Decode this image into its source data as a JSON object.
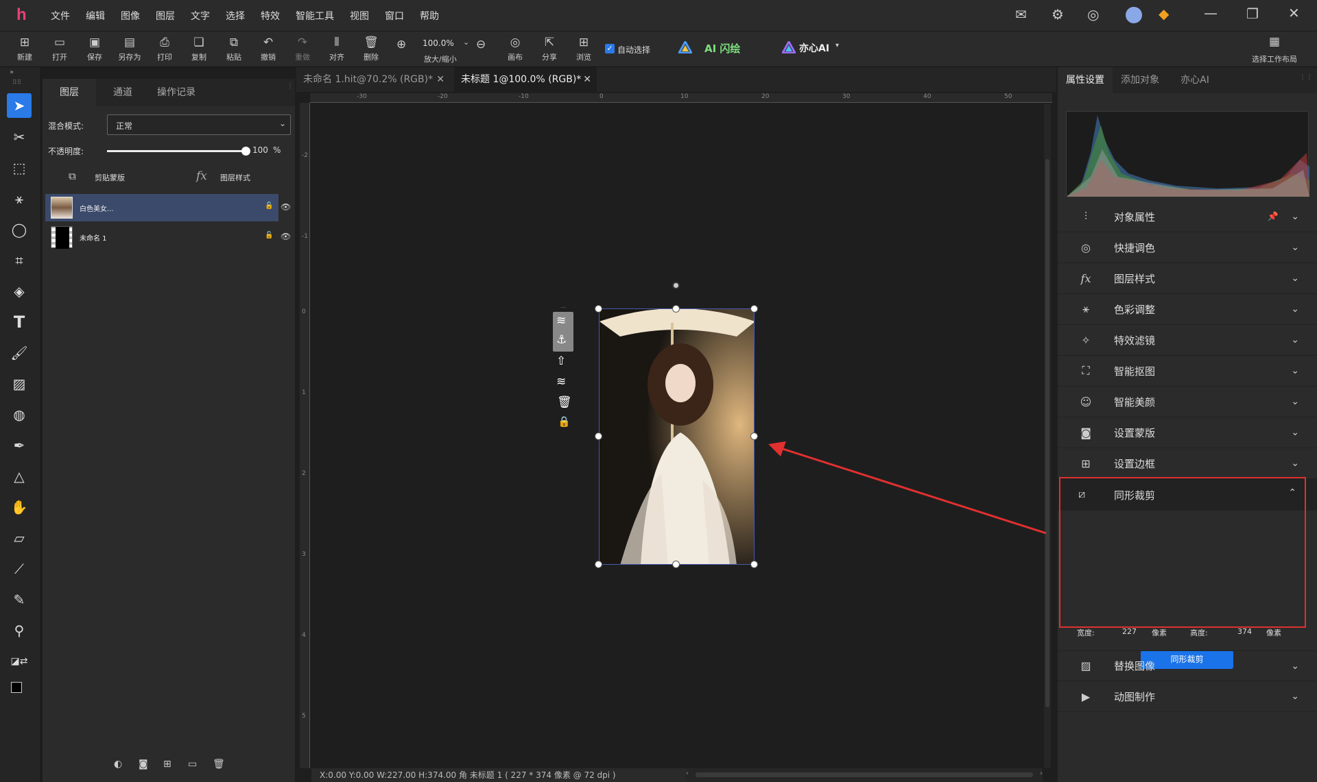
{
  "app": {
    "logo": "h"
  },
  "menu": [
    "文件",
    "编辑",
    "图像",
    "图层",
    "文字",
    "选择",
    "特效",
    "智能工具",
    "视图",
    "窗口",
    "帮助"
  ],
  "toolbar": {
    "new": "新建",
    "open": "打开",
    "save": "保存",
    "save_as": "另存为",
    "print": "打印",
    "copy": "复制",
    "paste": "粘贴",
    "undo": "撤销",
    "redo": "重做",
    "align": "对齐",
    "delete": "删除",
    "zoom_value": "100.0%",
    "zoom_label": "放大/缩小",
    "canvas": "画布",
    "share": "分享",
    "browse": "浏览",
    "auto_select": "自动选择",
    "ai_flash": "AI 闪绘",
    "yixin_ai": "亦心AI",
    "layout": "选择工作布局"
  },
  "layers_panel": {
    "tabs": [
      "图层",
      "通道",
      "操作记录"
    ],
    "blend_label": "混合模式:",
    "blend_value": "正常",
    "opacity_label": "不透明度:",
    "opacity_value": "100",
    "opacity_unit": "%",
    "opacity_fraction": 1.0,
    "clip_mask": "剪贴蒙版",
    "layer_style": "图层样式",
    "layers": [
      {
        "name": "白色美女..."
      },
      {
        "name": "未命名 1"
      }
    ]
  },
  "doc_tabs": [
    {
      "title": "未命名 1.hit@70.2% (RGB)*"
    },
    {
      "title": "未标题 1@100.0% (RGB)*"
    }
  ],
  "ruler_h": [
    "-30",
    "-20",
    "-10",
    "0",
    "10",
    "20",
    "30",
    "40",
    "50"
  ],
  "ruler_v": [
    "-2",
    "-1",
    "0",
    "1",
    "2",
    "3",
    "4",
    "5"
  ],
  "status": "X:0.00 Y:0.00 W:227.00 H:374.00 角     未标题 1 ( 227 * 374 像素 @ 72 dpi )",
  "right_panel": {
    "tabs": [
      "属性设置",
      "添加对象",
      "亦心AI"
    ],
    "items": [
      "对象属性",
      "快捷调色",
      "图层样式",
      "色彩调整",
      "特效滤镜",
      "智能抠图",
      "智能美颜",
      "设置蒙版",
      "设置边框"
    ],
    "crop": {
      "title": "同形裁剪",
      "width_label": "宽度:",
      "width_value": "227",
      "width_unit": "像素",
      "height_label": "高度:",
      "height_value": "374",
      "height_unit": "像素",
      "button": "同形裁剪"
    },
    "items_after": [
      "替换图像",
      "动图制作"
    ]
  },
  "colors": {
    "accent": "#1a73e8",
    "highlight_border": "#e03030",
    "arrow": "#e03030",
    "selection": "#3b4a6b"
  }
}
